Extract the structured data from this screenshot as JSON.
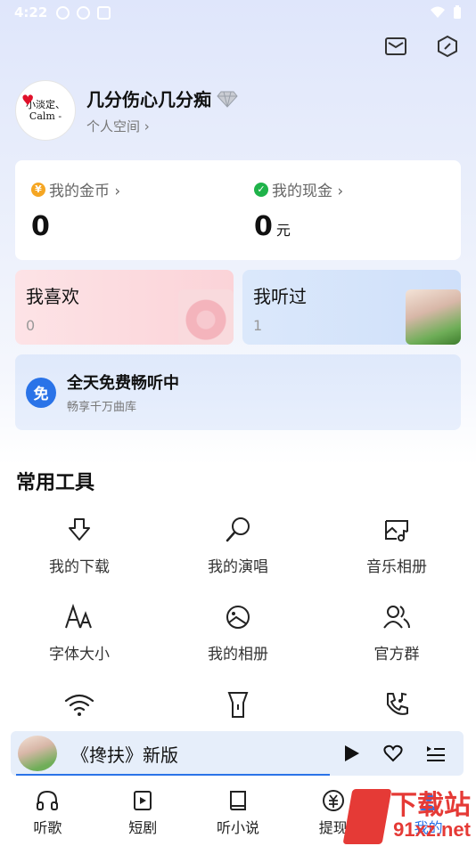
{
  "status": {
    "time": "4:22"
  },
  "profile": {
    "name": "几分伤心几分痴",
    "sub": "个人空间 ›",
    "avatar_line1": "小淡定、",
    "avatar_line2": "Calm -"
  },
  "wallet": {
    "gold_label": "我的金币 ›",
    "gold_value": "0",
    "cash_label": "我的现金 ›",
    "cash_value": "0",
    "cash_unit": "元"
  },
  "tiles": [
    {
      "title": "我喜欢",
      "count": "0"
    },
    {
      "title": "我听过",
      "count": "1"
    }
  ],
  "banner": {
    "icon": "免",
    "title": "全天免费畅听中",
    "sub": "畅享千万曲库"
  },
  "section_title": "常用工具",
  "tools": [
    {
      "label": "我的下载",
      "icon": "download-icon"
    },
    {
      "label": "我的演唱",
      "icon": "microphone-icon"
    },
    {
      "label": "音乐相册",
      "icon": "music-album-icon"
    },
    {
      "label": "字体大小",
      "icon": "font-size-icon"
    },
    {
      "label": "我的相册",
      "icon": "photo-album-icon"
    },
    {
      "label": "官方群",
      "icon": "group-icon"
    }
  ],
  "player": {
    "title": "《搀扶》新版"
  },
  "tabs": [
    {
      "label": "听歌",
      "icon": "headphones-icon"
    },
    {
      "label": "短剧",
      "icon": "video-icon"
    },
    {
      "label": "听小说",
      "icon": "book-icon"
    },
    {
      "label": "提现",
      "icon": "withdraw-icon"
    },
    {
      "label": "我的",
      "icon": "user-icon"
    }
  ],
  "watermark": {
    "text1": "下载站",
    "text2": "91xz.net"
  },
  "colors": {
    "accent": "#2a73e8",
    "gold": "#f5a623",
    "cash": "#1fb34a"
  }
}
